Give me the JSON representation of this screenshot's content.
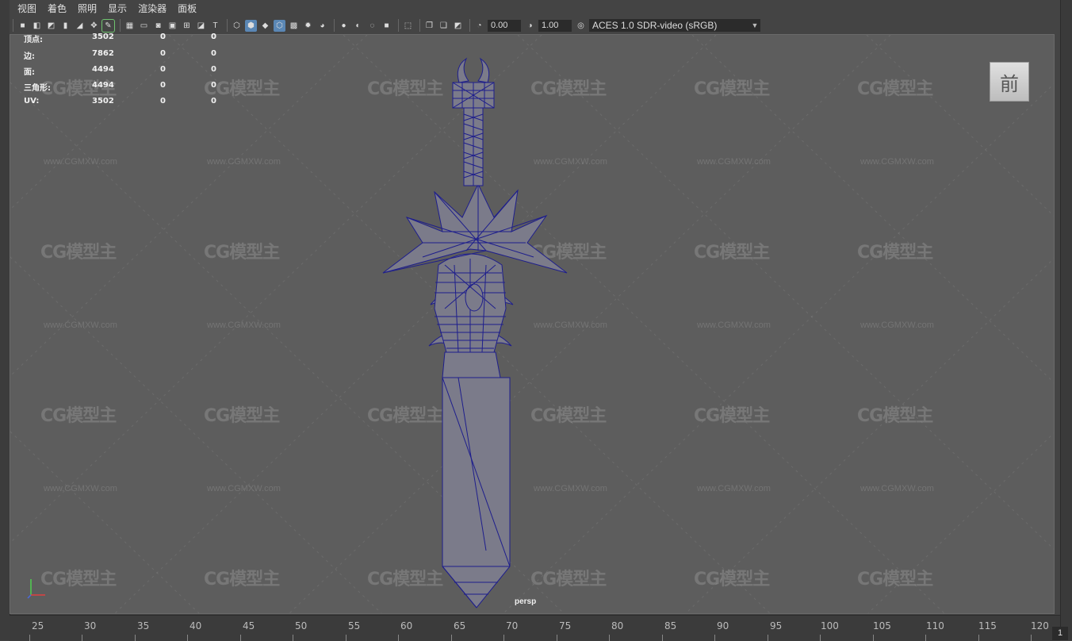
{
  "menu": [
    "视图",
    "着色",
    "照明",
    "显示",
    "渲染器",
    "面板"
  ],
  "toolbar": {
    "exposure": "0.00",
    "gamma": "1.00",
    "color_space": "ACES 1.0 SDR-video (sRGB)"
  },
  "hud": {
    "rows": [
      {
        "label": "顶点:",
        "v1": "3502",
        "v2": "0",
        "v3": "0"
      },
      {
        "label": "边:",
        "v1": "7862",
        "v2": "0",
        "v3": "0"
      },
      {
        "label": "面:",
        "v1": "4494",
        "v2": "0",
        "v3": "0"
      },
      {
        "label": "三角形:",
        "v1": "4494",
        "v2": "0",
        "v3": "0"
      },
      {
        "label": "UV:",
        "v1": "3502",
        "v2": "0",
        "v3": "0"
      }
    ],
    "top_values": [
      "0",
      "0"
    ]
  },
  "viewcube_label": "前",
  "camera_label": "persp",
  "watermark": {
    "brand": "CG模型主",
    "url": "www.CGMXW.com"
  },
  "timeline": {
    "ticks": [
      "25",
      "30",
      "35",
      "40",
      "45",
      "50",
      "55",
      "60",
      "65",
      "70",
      "75",
      "80",
      "85",
      "90",
      "95",
      "100",
      "105",
      "110",
      "115",
      "120"
    ],
    "current_frame": "1"
  },
  "colors": {
    "viewport_bg": "#5d5d5d",
    "wireframe": "#1e1e8c",
    "mesh_fill": "#7b7b8a",
    "highlight": "#5a87b5"
  }
}
